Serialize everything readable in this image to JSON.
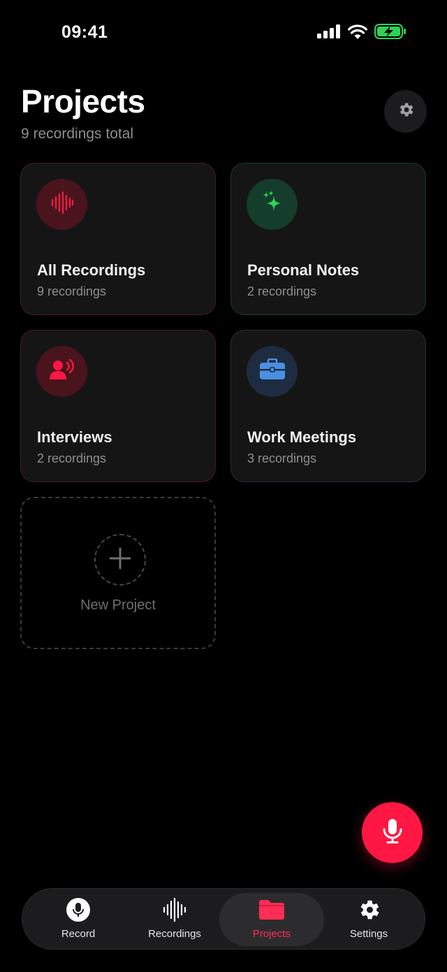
{
  "status_bar": {
    "time": "09:41",
    "icons": [
      "cellular-signal-icon",
      "wifi-icon",
      "battery-charging-icon"
    ]
  },
  "header": {
    "title": "Projects",
    "subtitle": "9 recordings total",
    "settings_icon": "gear-icon"
  },
  "projects": [
    {
      "title": "All Recordings",
      "count": "9 recordings",
      "icon": "waveform-icon",
      "accent": "#ff2d55"
    },
    {
      "title": "Personal Notes",
      "count": "2 recordings",
      "icon": "sparkles-icon",
      "accent": "#30d158"
    },
    {
      "title": "Interviews",
      "count": "2 recordings",
      "icon": "person-speaking-icon",
      "accent": "#ff2d55"
    },
    {
      "title": "Work Meetings",
      "count": "3 recordings",
      "icon": "briefcase-icon",
      "accent": "#4a90e2"
    }
  ],
  "new_project": {
    "label": "New Project",
    "icon": "plus-icon"
  },
  "fab": {
    "icon": "microphone-icon",
    "color": "#ff1744"
  },
  "tab_bar": {
    "active": "Projects",
    "tabs": [
      {
        "label": "Record",
        "icon": "microphone-circle-icon"
      },
      {
        "label": "Recordings",
        "icon": "waveform-icon"
      },
      {
        "label": "Projects",
        "icon": "folder-icon"
      },
      {
        "label": "Settings",
        "icon": "gear-icon"
      }
    ]
  },
  "colors": {
    "background": "#000000",
    "card": "#151515",
    "accent_red": "#ff2d55",
    "accent_green": "#30d158",
    "accent_blue": "#4a90e2",
    "secondary_text": "#8e8e93"
  }
}
